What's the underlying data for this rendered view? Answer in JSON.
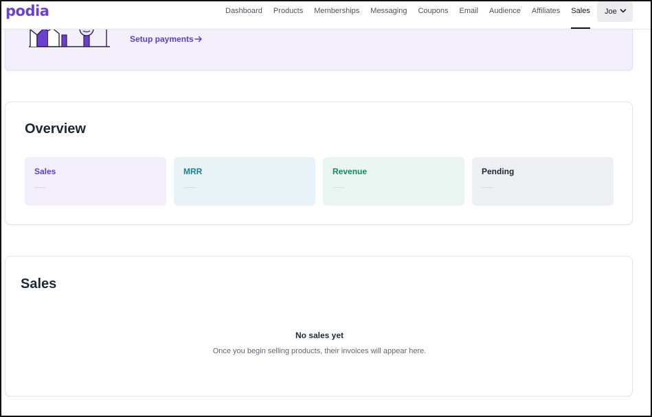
{
  "app": {
    "logo": "podia"
  },
  "nav": {
    "items": [
      "Dashboard",
      "Products",
      "Memberships",
      "Messaging",
      "Coupons",
      "Email",
      "Audience",
      "Affiliates",
      "Sales"
    ],
    "active": "Sales"
  },
  "user": {
    "name": "Joe"
  },
  "banner": {
    "setup_link": "Setup payments"
  },
  "overview": {
    "title": "Overview",
    "stats": [
      {
        "label": "Sales",
        "value": "—"
      },
      {
        "label": "MRR",
        "value": "—"
      },
      {
        "label": "Revenue",
        "value": "—"
      },
      {
        "label": "Pending",
        "value": "—"
      }
    ]
  },
  "sales": {
    "title": "Sales",
    "empty_title": "No sales yet",
    "empty_desc": "Once you begin selling products, their invoices will appear here."
  },
  "colors": {
    "brand": "#6b3fd0",
    "link": "#5b3ec4"
  }
}
